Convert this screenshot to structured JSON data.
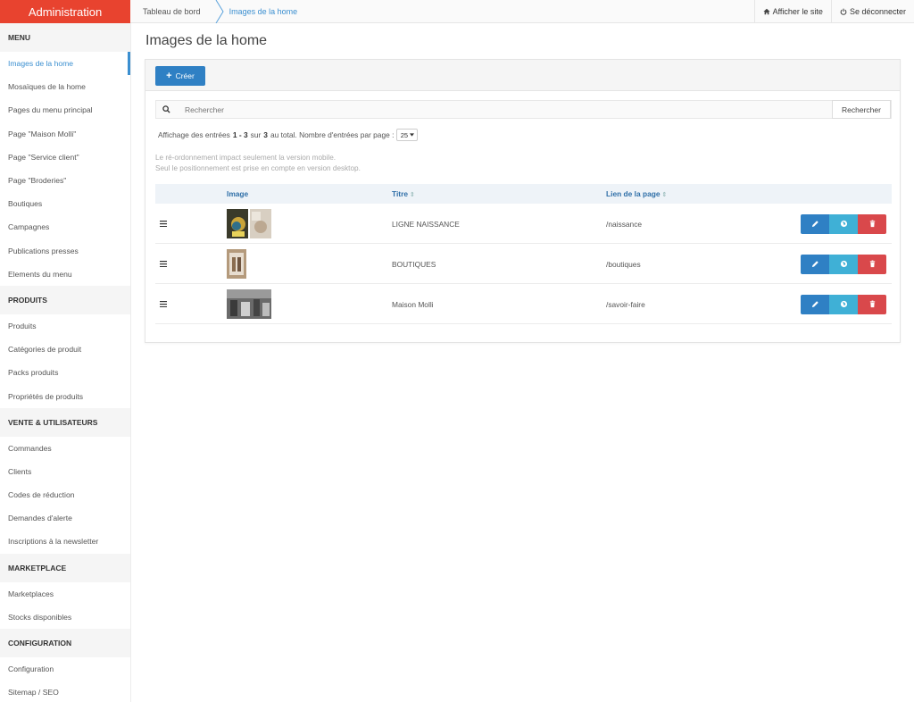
{
  "brand": "Administration",
  "breadcrumb": {
    "home": "Tableau de bord",
    "current": "Images de la home"
  },
  "top_links": {
    "site": "Afficher le site",
    "logout": "Se déconnecter"
  },
  "sidebar": {
    "sections": [
      {
        "title": "MENU",
        "items": [
          "Images de la home",
          "Mosaïques de la home",
          "Pages du menu principal",
          "Page \"Maison Molli\"",
          "Page \"Service client\"",
          "Page \"Broderies\"",
          "Boutiques",
          "Campagnes",
          "Publications presses",
          "Elements du menu"
        ]
      },
      {
        "title": "PRODUITS",
        "items": [
          "Produits",
          "Catégories de produit",
          "Packs produits",
          "Propriétés de produits"
        ]
      },
      {
        "title": "VENTE & UTILISATEURS",
        "items": [
          "Commandes",
          "Clients",
          "Codes de réduction",
          "Demandes d'alerte",
          "Inscriptions à la newsletter"
        ]
      },
      {
        "title": "MARKETPLACE",
        "items": [
          "Marketplaces",
          "Stocks disponibles"
        ]
      },
      {
        "title": "CONFIGURATION",
        "items": [
          "Configuration",
          "Sitemap / SEO"
        ]
      }
    ],
    "active_item": "Images de la home"
  },
  "page": {
    "title": "Images de la home",
    "create_label": "Créer"
  },
  "search": {
    "placeholder": "Rechercher",
    "button": "Rechercher"
  },
  "info": {
    "prefix": "Affichage des entrées",
    "range": "1 - 3",
    "sur": "sur",
    "total": "3",
    "suffix": "au total. Nombre d'entrées par page :",
    "per_page": "25"
  },
  "note": {
    "line1": "Le ré-ordonnement impact seulement la version mobile.",
    "line2": "Seul le positionnement est prise en compte en version desktop."
  },
  "table": {
    "headers": {
      "image": "Image",
      "title": "Titre",
      "link": "Lien de la page"
    },
    "rows": [
      {
        "title": "LIGNE NAISSANCE",
        "link": "/naissance"
      },
      {
        "title": "BOUTIQUES",
        "link": "/boutiques"
      },
      {
        "title": "Maison Molli",
        "link": "/savoir-faire"
      }
    ]
  },
  "colors": {
    "brand": "#e8432f",
    "primary": "#2f80c4",
    "info": "#3fb0d6",
    "danger": "#d9484b",
    "link": "#3b8fd0"
  }
}
